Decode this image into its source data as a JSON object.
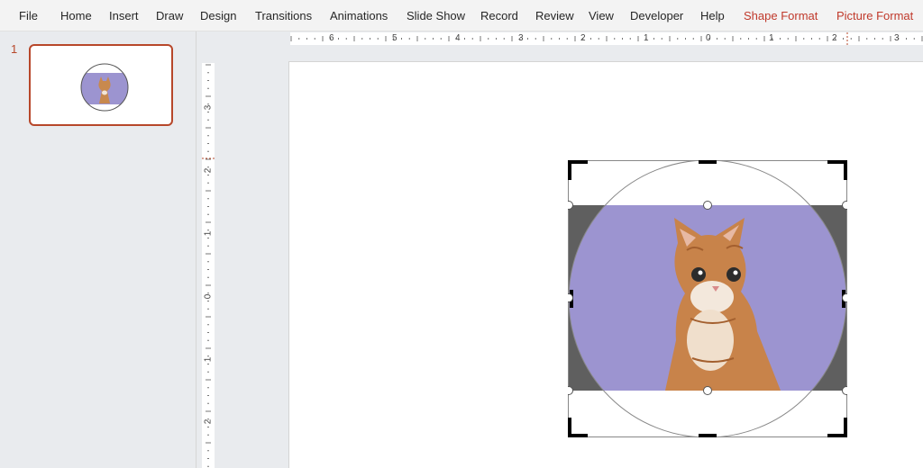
{
  "ribbon": {
    "tabs": [
      "File",
      "Home",
      "Insert",
      "Draw",
      "Design",
      "Transitions",
      "Animations",
      "Slide Show",
      "Record",
      "Review",
      "View",
      "Developer",
      "Help"
    ],
    "context_tabs": [
      "Shape Format",
      "Picture Format"
    ]
  },
  "thumbnails": {
    "slide_number": "1"
  },
  "rulers": {
    "horizontal_labels": [
      "6",
      "5",
      "4",
      "3",
      "2",
      "1",
      "0",
      "1",
      "2",
      "3"
    ],
    "vertical_labels": [
      "3",
      "2",
      "1",
      "0",
      "1",
      "2"
    ]
  },
  "colors": {
    "accent": "#b7472a",
    "context_tab": "#c0392b",
    "photo_background": "#9c94d0",
    "crop_fill": "#5f5f5f"
  }
}
